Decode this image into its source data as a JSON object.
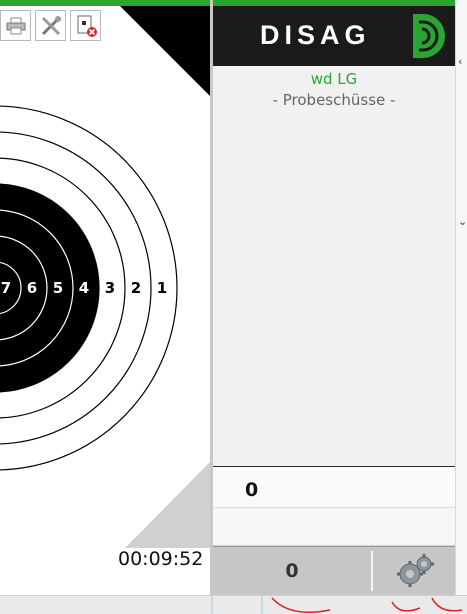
{
  "toolbar": {
    "buttons": [
      {
        "name": "print-icon"
      },
      {
        "name": "tools-icon"
      },
      {
        "name": "disconnect-icon"
      }
    ]
  },
  "target": {
    "ring_numbers": [
      "7",
      "6",
      "5",
      "4",
      "3",
      "2",
      "1"
    ],
    "colors": {
      "black_zone": "#000000",
      "white_zone": "#ffffff",
      "corner": "#d0d0d0"
    }
  },
  "timer": "00:09:52",
  "brand": {
    "logo_text": "DISAG",
    "accent": "#2aa533",
    "logo_bg": "#1a1a1a"
  },
  "session": {
    "discipline": "wd LG",
    "mode": "- Probeschüsse -"
  },
  "score": {
    "value": "0"
  },
  "footer": {
    "shot_count": "0",
    "settings_icon": "gears-icon"
  }
}
